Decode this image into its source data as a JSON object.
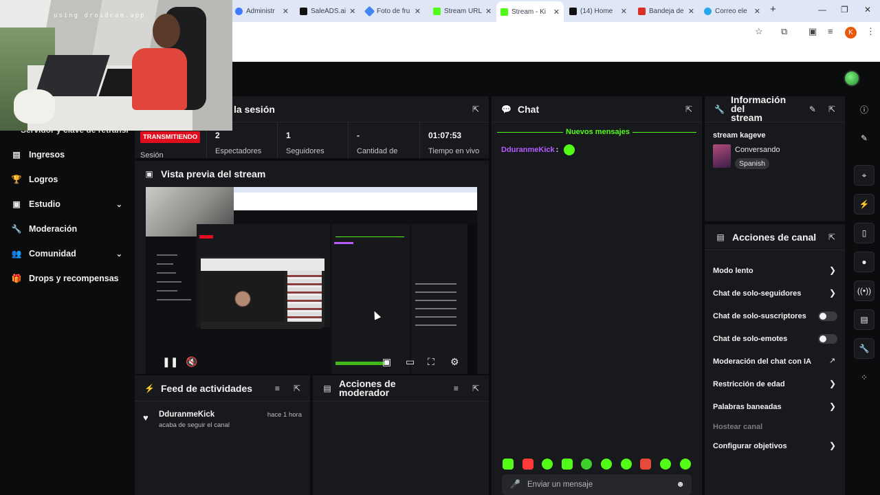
{
  "browser": {
    "tabs": [
      {
        "label": "Administr",
        "color": "#3d7cff"
      },
      {
        "label": "SaleADS.ai",
        "color": "#111111"
      },
      {
        "label": "Foto de fru",
        "color": "#4285f4"
      },
      {
        "label": "Stream URL",
        "color": "#53fc18"
      },
      {
        "label": "Stream - Ki",
        "color": "#53fc18"
      },
      {
        "label": "(14) Home",
        "color": "#111111"
      },
      {
        "label": "Bandeja de",
        "color": "#d93025"
      },
      {
        "label": "Correo ele",
        "color": "#28a8ea"
      }
    ],
    "profile_letter": "K"
  },
  "webcam": {
    "watermark": "using droidcam.app"
  },
  "sidebar": {
    "partial_label": "Servidor y clave de retransr",
    "items": [
      {
        "label": "Ingresos",
        "icon": "bar-chart-icon",
        "chevron": false
      },
      {
        "label": "Logros",
        "icon": "trophy-icon",
        "chevron": false
      },
      {
        "label": "Estudio",
        "icon": "studio-icon",
        "chevron": true
      },
      {
        "label": "Moderación",
        "icon": "wrench-icon",
        "chevron": false
      },
      {
        "label": "Comunidad",
        "icon": "people-icon",
        "chevron": true
      },
      {
        "label": "Drops y recompensas",
        "icon": "gift-icon",
        "chevron": false
      }
    ]
  },
  "session": {
    "title": "la sesión",
    "badge": "TRANSMITIENDO",
    "badge_label": "Sesión",
    "stats": [
      {
        "value": "2",
        "label": "Espectadores"
      },
      {
        "value": "1",
        "label": "Seguidores"
      },
      {
        "value": "-",
        "label": "Cantidad de"
      },
      {
        "value": "01:07:53",
        "label": "Tiempo en vivo"
      }
    ]
  },
  "preview": {
    "title": "Vista previa del stream"
  },
  "feed": {
    "title": "Feed de actividades",
    "items": [
      {
        "user": "DduranmeKick",
        "action": "acaba de seguir el canal",
        "time": "hace 1 hora"
      }
    ]
  },
  "mod_actions": {
    "title_line1": "Acciones de",
    "title_line2": "moderador"
  },
  "chat": {
    "title": "Chat",
    "new_messages": "Nuevos mensajes",
    "messages": [
      {
        "user": "DduranmeKick",
        "sep": ":"
      }
    ],
    "input_placeholder": "Enviar un mensaje",
    "accent": "#53fc18",
    "user_color": "#b45cff"
  },
  "stream_info": {
    "title_line1": "Información del",
    "title_line2": "stream",
    "stream_name": "stream kageve",
    "category": "Conversando",
    "language": "Spanish"
  },
  "channel_actions": {
    "title": "Acciones de canal",
    "items": [
      {
        "label": "Modo lento",
        "control": "arrow"
      },
      {
        "label": "Chat de solo-seguidores",
        "control": "arrow"
      },
      {
        "label": "Chat de solo-suscriptores",
        "control": "toggle",
        "on": false
      },
      {
        "label": "Chat de solo-emotes",
        "control": "toggle",
        "on": false
      },
      {
        "label": "Moderación del chat con IA",
        "control": "external"
      },
      {
        "label": "Restricción de edad",
        "control": "arrow"
      },
      {
        "label": "Palabras baneadas",
        "control": "arrow"
      },
      {
        "label": "Hostear canal",
        "control": "none",
        "disabled": true
      },
      {
        "label": "Configurar objetivos",
        "control": "arrow"
      }
    ]
  }
}
